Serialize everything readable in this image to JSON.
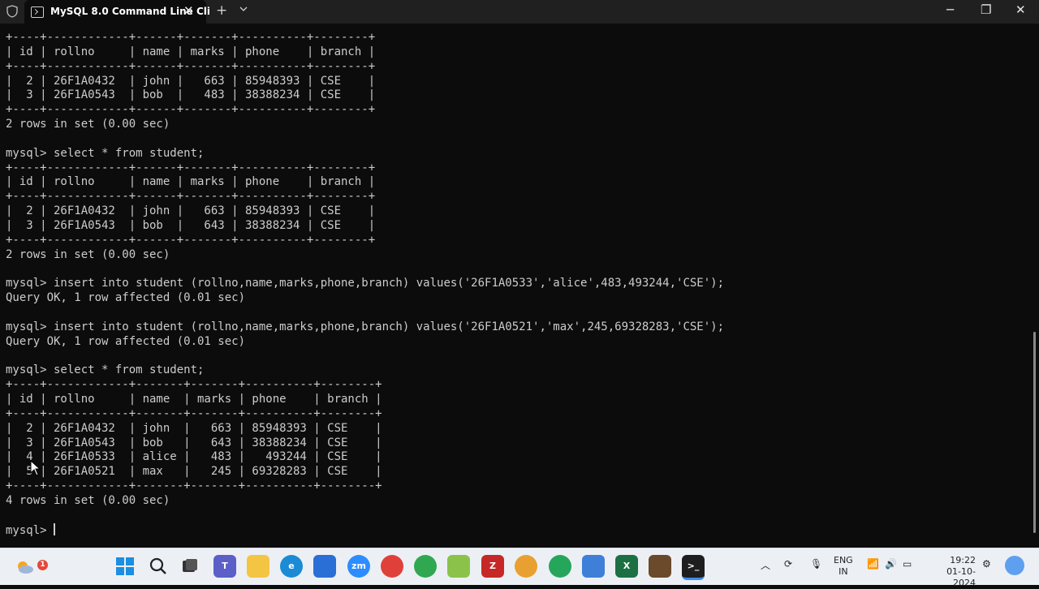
{
  "window": {
    "tab_title": "MySQL 8.0 Command Line Cli",
    "close_tab": "✕",
    "new_tab": "+",
    "minimize": "─",
    "maximize": "❐",
    "close": "✕"
  },
  "terminal": {
    "lines": [
      "+----+------------+------+-------+----------+--------+",
      "| id | rollno     | name | marks | phone    | branch |",
      "+----+------------+------+-------+----------+--------+",
      "|  2 | 26F1A0432  | john |   663 | 85948393 | CSE    |",
      "|  3 | 26F1A0543  | bob  |   483 | 38388234 | CSE    |",
      "+----+------------+------+-------+----------+--------+",
      "2 rows in set (0.00 sec)",
      "",
      "mysql> select * from student;",
      "+----+------------+------+-------+----------+--------+",
      "| id | rollno     | name | marks | phone    | branch |",
      "+----+------------+------+-------+----------+--------+",
      "|  2 | 26F1A0432  | john |   663 | 85948393 | CSE    |",
      "|  3 | 26F1A0543  | bob  |   643 | 38388234 | CSE    |",
      "+----+------------+------+-------+----------+--------+",
      "2 rows in set (0.00 sec)",
      "",
      "mysql> insert into student (rollno,name,marks,phone,branch) values('26F1A0533','alice',483,493244,'CSE');",
      "Query OK, 1 row affected (0.01 sec)",
      "",
      "mysql> insert into student (rollno,name,marks,phone,branch) values('26F1A0521','max',245,69328283,'CSE');",
      "Query OK, 1 row affected (0.01 sec)",
      "",
      "mysql> select * from student;",
      "+----+------------+-------+-------+----------+--------+",
      "| id | rollno     | name  | marks | phone    | branch |",
      "+----+------------+-------+-------+----------+--------+",
      "|  2 | 26F1A0432  | john  |   663 | 85948393 | CSE    |",
      "|  3 | 26F1A0543  | bob   |   643 | 38388234 | CSE    |",
      "|  4 | 26F1A0533  | alice |   483 |   493244 | CSE    |",
      "|  5 | 26F1A0521  | max   |   245 | 69328283 | CSE    |",
      "+----+------------+-------+-------+----------+--------+",
      "4 rows in set (0.00 sec)",
      "",
      "mysql> "
    ]
  },
  "taskbar": {
    "notification_badge": "1",
    "apps": [
      {
        "name": "start-button",
        "icon": "windows-logo-icon"
      },
      {
        "name": "search-button",
        "icon": "search-icon"
      },
      {
        "name": "task-view-button",
        "icon": "task-view-icon"
      },
      {
        "name": "teams-button",
        "icon": "teams-icon"
      },
      {
        "name": "file-explorer-button",
        "icon": "folder-icon"
      },
      {
        "name": "edge-button",
        "icon": "edge-icon"
      },
      {
        "name": "store-button",
        "icon": "store-icon"
      },
      {
        "name": "zoom-button",
        "icon": "zoom-icon",
        "label": "zm"
      },
      {
        "name": "chrome-button-1",
        "icon": "chrome-icon"
      },
      {
        "name": "chrome-button-2",
        "icon": "chrome-icon"
      },
      {
        "name": "notepadpp-button",
        "icon": "notepadpp-icon"
      },
      {
        "name": "filezilla-button",
        "icon": "filezilla-icon"
      },
      {
        "name": "chrome-button-3",
        "icon": "chrome-icon"
      },
      {
        "name": "chrome-button-4",
        "icon": "chrome-icon"
      },
      {
        "name": "notepad-button",
        "icon": "notepad-icon"
      },
      {
        "name": "excel-button",
        "icon": "excel-icon"
      },
      {
        "name": "app-button",
        "icon": "app-icon"
      },
      {
        "name": "terminal-button",
        "icon": "terminal-icon"
      }
    ],
    "language_line1": "ENG",
    "language_line2": "IN",
    "time": "19:22",
    "date": "01-10-2024"
  }
}
